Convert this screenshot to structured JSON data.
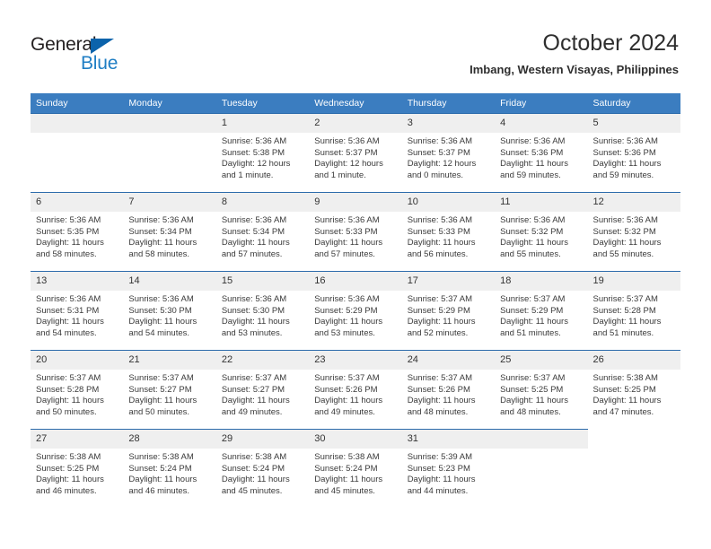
{
  "brand": {
    "name_part1": "General",
    "name_part2": "Blue",
    "triangle_color": "#0b63ab",
    "blue_text_color": "#1f7ec4"
  },
  "header": {
    "title": "October 2024",
    "subtitle": "Imbang, Western Visayas, Philippines",
    "header_bg_color": "#3b7dc0",
    "row_divider_color": "#2c6bab",
    "daynum_bg_color": "#efefef"
  },
  "weekdays": [
    "Sunday",
    "Monday",
    "Tuesday",
    "Wednesday",
    "Thursday",
    "Friday",
    "Saturday"
  ],
  "weeks": [
    [
      {
        "day": "",
        "blank": true
      },
      {
        "day": "",
        "blank": true
      },
      {
        "day": "1",
        "sunrise": "Sunrise: 5:36 AM",
        "sunset": "Sunset: 5:38 PM",
        "daylight_l1": "Daylight: 12 hours",
        "daylight_l2": "and 1 minute."
      },
      {
        "day": "2",
        "sunrise": "Sunrise: 5:36 AM",
        "sunset": "Sunset: 5:37 PM",
        "daylight_l1": "Daylight: 12 hours",
        "daylight_l2": "and 1 minute."
      },
      {
        "day": "3",
        "sunrise": "Sunrise: 5:36 AM",
        "sunset": "Sunset: 5:37 PM",
        "daylight_l1": "Daylight: 12 hours",
        "daylight_l2": "and 0 minutes."
      },
      {
        "day": "4",
        "sunrise": "Sunrise: 5:36 AM",
        "sunset": "Sunset: 5:36 PM",
        "daylight_l1": "Daylight: 11 hours",
        "daylight_l2": "and 59 minutes."
      },
      {
        "day": "5",
        "sunrise": "Sunrise: 5:36 AM",
        "sunset": "Sunset: 5:36 PM",
        "daylight_l1": "Daylight: 11 hours",
        "daylight_l2": "and 59 minutes."
      }
    ],
    [
      {
        "day": "6",
        "sunrise": "Sunrise: 5:36 AM",
        "sunset": "Sunset: 5:35 PM",
        "daylight_l1": "Daylight: 11 hours",
        "daylight_l2": "and 58 minutes."
      },
      {
        "day": "7",
        "sunrise": "Sunrise: 5:36 AM",
        "sunset": "Sunset: 5:34 PM",
        "daylight_l1": "Daylight: 11 hours",
        "daylight_l2": "and 58 minutes."
      },
      {
        "day": "8",
        "sunrise": "Sunrise: 5:36 AM",
        "sunset": "Sunset: 5:34 PM",
        "daylight_l1": "Daylight: 11 hours",
        "daylight_l2": "and 57 minutes."
      },
      {
        "day": "9",
        "sunrise": "Sunrise: 5:36 AM",
        "sunset": "Sunset: 5:33 PM",
        "daylight_l1": "Daylight: 11 hours",
        "daylight_l2": "and 57 minutes."
      },
      {
        "day": "10",
        "sunrise": "Sunrise: 5:36 AM",
        "sunset": "Sunset: 5:33 PM",
        "daylight_l1": "Daylight: 11 hours",
        "daylight_l2": "and 56 minutes."
      },
      {
        "day": "11",
        "sunrise": "Sunrise: 5:36 AM",
        "sunset": "Sunset: 5:32 PM",
        "daylight_l1": "Daylight: 11 hours",
        "daylight_l2": "and 55 minutes."
      },
      {
        "day": "12",
        "sunrise": "Sunrise: 5:36 AM",
        "sunset": "Sunset: 5:32 PM",
        "daylight_l1": "Daylight: 11 hours",
        "daylight_l2": "and 55 minutes."
      }
    ],
    [
      {
        "day": "13",
        "sunrise": "Sunrise: 5:36 AM",
        "sunset": "Sunset: 5:31 PM",
        "daylight_l1": "Daylight: 11 hours",
        "daylight_l2": "and 54 minutes."
      },
      {
        "day": "14",
        "sunrise": "Sunrise: 5:36 AM",
        "sunset": "Sunset: 5:30 PM",
        "daylight_l1": "Daylight: 11 hours",
        "daylight_l2": "and 54 minutes."
      },
      {
        "day": "15",
        "sunrise": "Sunrise: 5:36 AM",
        "sunset": "Sunset: 5:30 PM",
        "daylight_l1": "Daylight: 11 hours",
        "daylight_l2": "and 53 minutes."
      },
      {
        "day": "16",
        "sunrise": "Sunrise: 5:36 AM",
        "sunset": "Sunset: 5:29 PM",
        "daylight_l1": "Daylight: 11 hours",
        "daylight_l2": "and 53 minutes."
      },
      {
        "day": "17",
        "sunrise": "Sunrise: 5:37 AM",
        "sunset": "Sunset: 5:29 PM",
        "daylight_l1": "Daylight: 11 hours",
        "daylight_l2": "and 52 minutes."
      },
      {
        "day": "18",
        "sunrise": "Sunrise: 5:37 AM",
        "sunset": "Sunset: 5:29 PM",
        "daylight_l1": "Daylight: 11 hours",
        "daylight_l2": "and 51 minutes."
      },
      {
        "day": "19",
        "sunrise": "Sunrise: 5:37 AM",
        "sunset": "Sunset: 5:28 PM",
        "daylight_l1": "Daylight: 11 hours",
        "daylight_l2": "and 51 minutes."
      }
    ],
    [
      {
        "day": "20",
        "sunrise": "Sunrise: 5:37 AM",
        "sunset": "Sunset: 5:28 PM",
        "daylight_l1": "Daylight: 11 hours",
        "daylight_l2": "and 50 minutes."
      },
      {
        "day": "21",
        "sunrise": "Sunrise: 5:37 AM",
        "sunset": "Sunset: 5:27 PM",
        "daylight_l1": "Daylight: 11 hours",
        "daylight_l2": "and 50 minutes."
      },
      {
        "day": "22",
        "sunrise": "Sunrise: 5:37 AM",
        "sunset": "Sunset: 5:27 PM",
        "daylight_l1": "Daylight: 11 hours",
        "daylight_l2": "and 49 minutes."
      },
      {
        "day": "23",
        "sunrise": "Sunrise: 5:37 AM",
        "sunset": "Sunset: 5:26 PM",
        "daylight_l1": "Daylight: 11 hours",
        "daylight_l2": "and 49 minutes."
      },
      {
        "day": "24",
        "sunrise": "Sunrise: 5:37 AM",
        "sunset": "Sunset: 5:26 PM",
        "daylight_l1": "Daylight: 11 hours",
        "daylight_l2": "and 48 minutes."
      },
      {
        "day": "25",
        "sunrise": "Sunrise: 5:37 AM",
        "sunset": "Sunset: 5:25 PM",
        "daylight_l1": "Daylight: 11 hours",
        "daylight_l2": "and 48 minutes."
      },
      {
        "day": "26",
        "sunrise": "Sunrise: 5:38 AM",
        "sunset": "Sunset: 5:25 PM",
        "daylight_l1": "Daylight: 11 hours",
        "daylight_l2": "and 47 minutes."
      }
    ],
    [
      {
        "day": "27",
        "sunrise": "Sunrise: 5:38 AM",
        "sunset": "Sunset: 5:25 PM",
        "daylight_l1": "Daylight: 11 hours",
        "daylight_l2": "and 46 minutes."
      },
      {
        "day": "28",
        "sunrise": "Sunrise: 5:38 AM",
        "sunset": "Sunset: 5:24 PM",
        "daylight_l1": "Daylight: 11 hours",
        "daylight_l2": "and 46 minutes."
      },
      {
        "day": "29",
        "sunrise": "Sunrise: 5:38 AM",
        "sunset": "Sunset: 5:24 PM",
        "daylight_l1": "Daylight: 11 hours",
        "daylight_l2": "and 45 minutes."
      },
      {
        "day": "30",
        "sunrise": "Sunrise: 5:38 AM",
        "sunset": "Sunset: 5:24 PM",
        "daylight_l1": "Daylight: 11 hours",
        "daylight_l2": "and 45 minutes."
      },
      {
        "day": "31",
        "sunrise": "Sunrise: 5:39 AM",
        "sunset": "Sunset: 5:23 PM",
        "daylight_l1": "Daylight: 11 hours",
        "daylight_l2": "and 44 minutes."
      },
      {
        "day": "",
        "blank": true
      },
      {
        "day": "",
        "blank": true,
        "no_band": true
      }
    ]
  ]
}
